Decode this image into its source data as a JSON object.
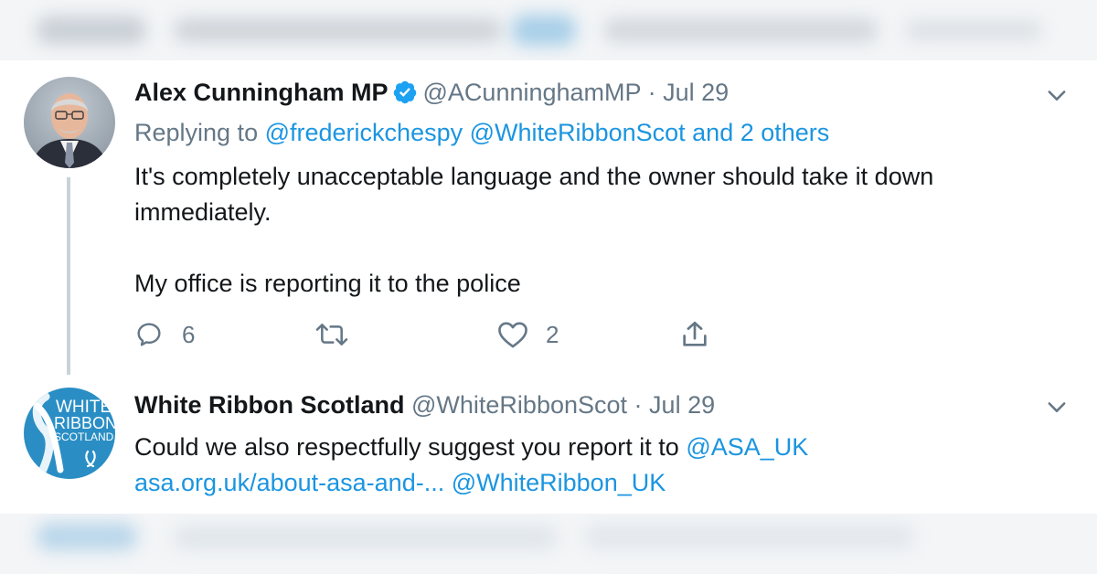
{
  "colors": {
    "link": "#1b95e0",
    "muted": "#657786",
    "text": "#14171a",
    "verified": "#1da1f2",
    "wrs_logo_bg": "#2a8ec5"
  },
  "tweets": [
    {
      "avatar_icon": "profile-photo",
      "name": "Alex Cunningham MP",
      "verified": true,
      "handle": "@ACunninghamMP",
      "separator": "·",
      "date": "Jul 29",
      "replying_prefix": "Replying to",
      "replying_mentions": [
        "@frederickchespy",
        "@WhiteRibbonScot",
        "and 2 others"
      ],
      "text_lines": [
        "It's completely unacceptable language and the owner should take it down",
        "immediately.",
        "My office is reporting it to the police"
      ],
      "actions": {
        "reply_count": "6",
        "like_count": "2"
      }
    },
    {
      "avatar_icon": "white-ribbon-scotland-logo",
      "logo_text": [
        "WHITE",
        "RIBBON",
        "SCOTLAND"
      ],
      "name": "White Ribbon Scotland",
      "handle": "@WhiteRibbonScot",
      "separator": "·",
      "date": "Jul 29",
      "text_prefix": "Could we also respectfully suggest you report it to",
      "mention_asa": "@ASA_UK",
      "url_text": "asa.org.uk/about-asa-and-...",
      "mention_wr": "@WhiteRibbon_UK"
    }
  ]
}
